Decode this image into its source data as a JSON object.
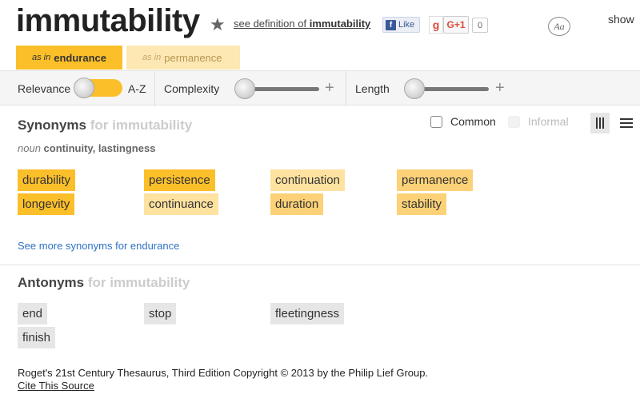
{
  "header": {
    "word": "immutability",
    "see_definition_prefix": "see definition of",
    "see_definition_word": "immutability",
    "fb_like": "Like",
    "gplus_label": "G+1",
    "gplus_count": "0",
    "font_button": "Aa",
    "show_link": "show"
  },
  "senses": [
    {
      "as_in": "as in",
      "term": "endurance"
    },
    {
      "as_in": "as in",
      "term": "permanence"
    }
  ],
  "filters": {
    "relevance": "Relevance",
    "az": "A-Z",
    "complexity": "Complexity",
    "length": "Length",
    "plus": "+"
  },
  "synonyms": {
    "title": "Synonyms",
    "for_text": "for immutability",
    "pos": "noun",
    "pos_words": "continuity, lastingness",
    "common_label": "Common",
    "informal_label": "Informal",
    "words": [
      "durability",
      "persistence",
      "continuation",
      "permanence",
      "longevity",
      "continuance",
      "duration",
      "stability"
    ],
    "see_more": "See more synonyms for endurance"
  },
  "antonyms": {
    "title": "Antonyms",
    "for_text": "for immutability",
    "words": [
      "end",
      "stop",
      "fleetingness",
      "finish"
    ]
  },
  "footer": {
    "copyright": "Roget's 21st Century Thesaurus, Third Edition Copyright © 2013 by the Philip Lief Group.",
    "cite": "Cite This Source"
  },
  "colors": {
    "relevance_1": "#fbbf2a",
    "relevance_2": "#fcd177",
    "relevance_3": "#fde2a0",
    "antonym_chip": "#e6e6e6",
    "link": "#2f72c4"
  }
}
